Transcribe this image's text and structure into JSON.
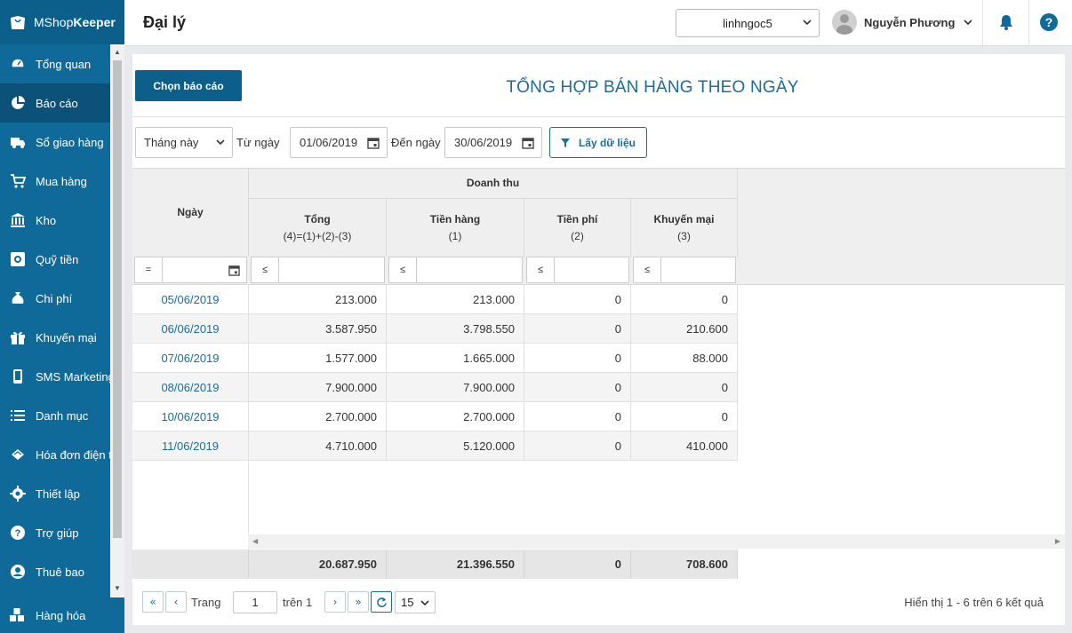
{
  "app": {
    "brand_light": "MShop",
    "brand_bold": "Keeper"
  },
  "sidebar": {
    "items": [
      {
        "label": "Tổng quan",
        "icon": "dashboard-icon"
      },
      {
        "label": "Báo cáo",
        "icon": "pie-chart-icon",
        "active": true
      },
      {
        "label": "Sổ giao hàng",
        "icon": "delivery-truck-icon"
      },
      {
        "label": "Mua hàng",
        "icon": "cart-icon"
      },
      {
        "label": "Kho",
        "icon": "warehouse-icon"
      },
      {
        "label": "Quỹ tiền",
        "icon": "safe-icon"
      },
      {
        "label": "Chi phí",
        "icon": "money-bag-icon"
      },
      {
        "label": "Khuyến mại",
        "icon": "gift-icon"
      },
      {
        "label": "SMS Marketing",
        "icon": "phone-icon"
      },
      {
        "label": "Danh mục",
        "icon": "list-icon"
      },
      {
        "label": "Hóa đơn điện tử",
        "icon": "invoice-icon"
      },
      {
        "label": "Thiết lập",
        "icon": "gear-icon"
      },
      {
        "label": "Trợ giúp",
        "icon": "help-icon"
      },
      {
        "label": "Thuê bao",
        "icon": "user-circle-icon"
      }
    ],
    "bottom": {
      "label": "Hàng hóa",
      "icon": "boxes-icon"
    }
  },
  "header": {
    "title": "Đại lý",
    "store": "linhngoc5",
    "user_name": "Nguyễn Phương"
  },
  "report": {
    "choose_label": "Chọn báo cáo",
    "title": "TỔNG HỢP BÁN HÀNG THEO NGÀY",
    "period": "Tháng này",
    "from_label": "Từ ngày",
    "from_date": "01/06/2019",
    "to_label": "Đến ngày",
    "to_date": "30/06/2019",
    "fetch_label": "Lấy dữ liệu"
  },
  "grid": {
    "date_header": "Ngày",
    "group_header": "Doanh thu",
    "columns": [
      {
        "line1": "Tổng",
        "line2": "(4)=(1)+(2)-(3)"
      },
      {
        "line1": "Tiền hàng",
        "line2": "(1)"
      },
      {
        "line1": "Tiền phí",
        "line2": "(2)"
      },
      {
        "line1": "Khuyến mại",
        "line2": "(3)"
      }
    ],
    "filter_ops": [
      "=",
      "≤",
      "≤",
      "≤",
      "≤"
    ],
    "rows": [
      {
        "date": "05/06/2019",
        "tong": "213.000",
        "tien_hang": "213.000",
        "tien_phi": "0",
        "khuyen_mai": "0"
      },
      {
        "date": "06/06/2019",
        "tong": "3.587.950",
        "tien_hang": "3.798.550",
        "tien_phi": "0",
        "khuyen_mai": "210.600"
      },
      {
        "date": "07/06/2019",
        "tong": "1.577.000",
        "tien_hang": "1.665.000",
        "tien_phi": "0",
        "khuyen_mai": "88.000"
      },
      {
        "date": "08/06/2019",
        "tong": "7.900.000",
        "tien_hang": "7.900.000",
        "tien_phi": "0",
        "khuyen_mai": "0"
      },
      {
        "date": "10/06/2019",
        "tong": "2.700.000",
        "tien_hang": "2.700.000",
        "tien_phi": "0",
        "khuyen_mai": "0"
      },
      {
        "date": "11/06/2019",
        "tong": "4.710.000",
        "tien_hang": "5.120.000",
        "tien_phi": "0",
        "khuyen_mai": "410.000"
      }
    ],
    "totals": {
      "tong": "20.687.950",
      "tien_hang": "21.396.550",
      "tien_phi": "0",
      "khuyen_mai": "708.600"
    }
  },
  "pager": {
    "page_label": "Trang",
    "page": "1",
    "of_label": "trên 1",
    "page_size": "15",
    "result_text": "Hiển thị 1 - 6 trên 6 kết quả"
  }
}
